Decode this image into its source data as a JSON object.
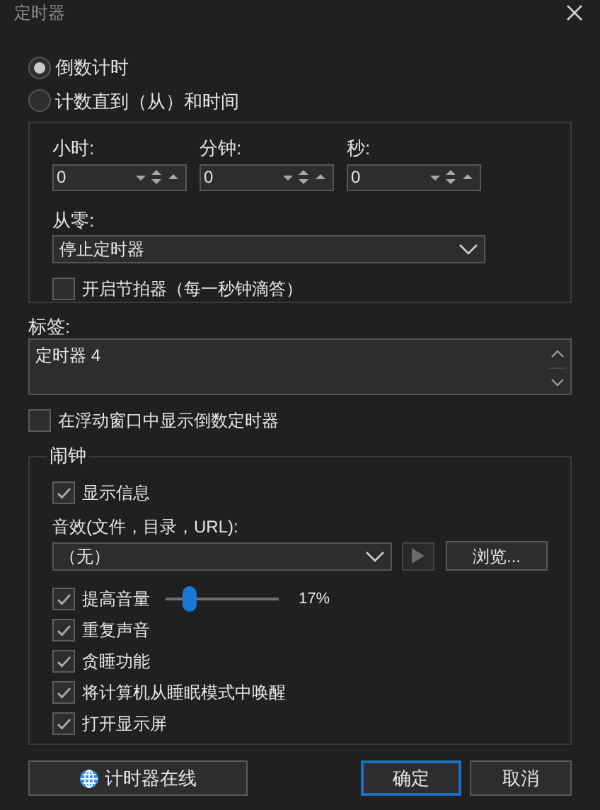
{
  "window": {
    "title": "定时器"
  },
  "mode_options": [
    {
      "label": "倒数计时",
      "selected": true
    },
    {
      "label": "计数直到（从）和时间",
      "selected": false
    }
  ],
  "time_fields": [
    {
      "label": "小时:",
      "value": "0"
    },
    {
      "label": "分钟:",
      "value": "0"
    },
    {
      "label": "秒:",
      "value": "0"
    }
  ],
  "from_zero": {
    "label": "从零:",
    "value": "停止定时器"
  },
  "metronome": {
    "label": "开启节拍器（每一秒钟滴答）",
    "checked": false
  },
  "tag": {
    "label": "标签:",
    "value": "定时器 4"
  },
  "floating_window": {
    "label": "在浮动窗口中显示倒数定时器",
    "checked": false
  },
  "alarm": {
    "title": "闹钟",
    "show_message": {
      "label": "显示信息",
      "checked": true
    },
    "sound": {
      "label": "音效(文件，目录，URL):",
      "value": "（无）",
      "browse": "浏览..."
    },
    "options": [
      {
        "kind": "slider",
        "label": "提高音量",
        "checked": true,
        "level": 0.17,
        "reading": "17%"
      },
      {
        "kind": "checkbox",
        "label": "重复声音",
        "checked": true
      },
      {
        "kind": "checkbox",
        "label": "贪睡功能",
        "checked": true
      },
      {
        "kind": "checkbox",
        "label": "将计算机从睡眠模式中唤醒",
        "checked": true
      },
      {
        "kind": "checkbox",
        "label": "打开显示屏",
        "checked": true
      }
    ]
  },
  "buttons": [
    {
      "kind": "online",
      "label": "计时器在线"
    },
    {
      "kind": "default",
      "label": "确定"
    },
    {
      "kind": "normal",
      "label": "取消"
    }
  ]
}
